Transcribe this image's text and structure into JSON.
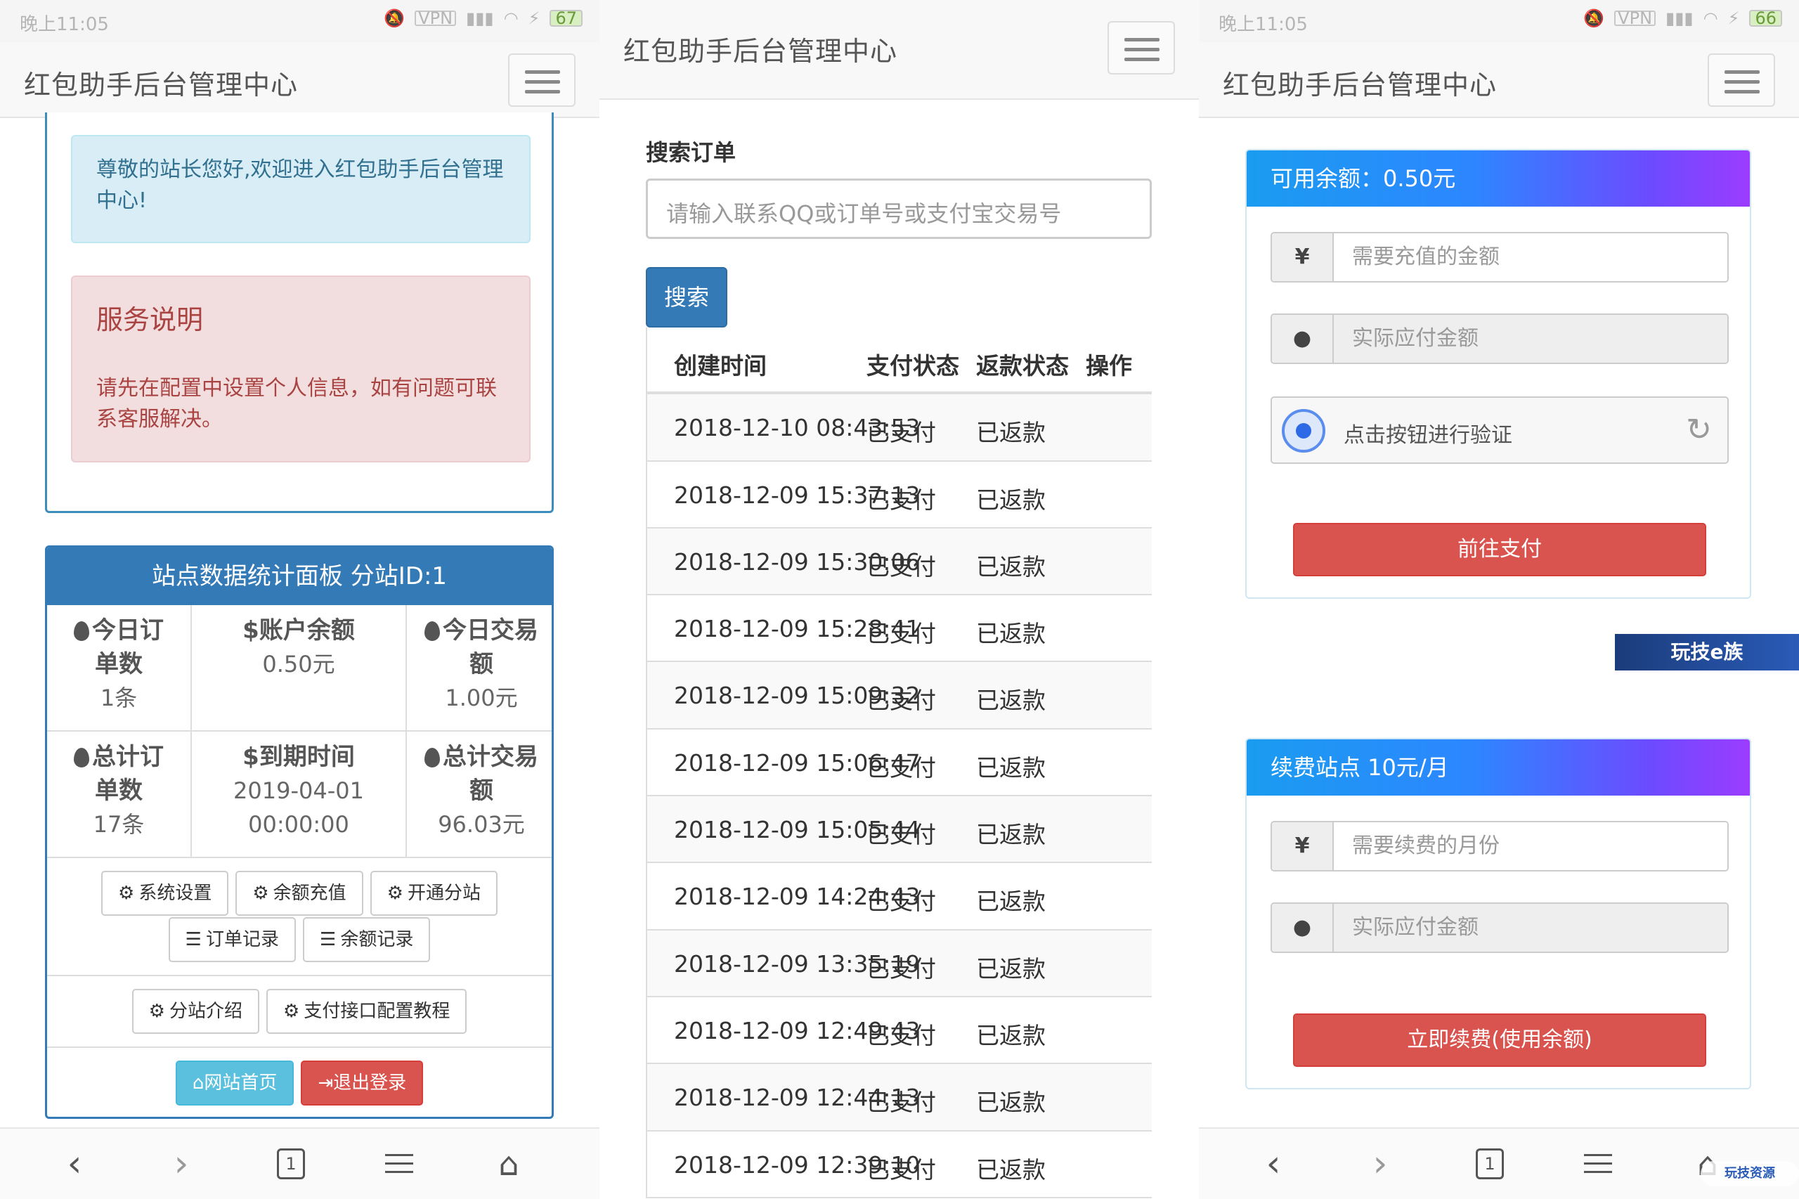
{
  "status_left": {
    "time": "晚上11:05",
    "battery": "67"
  },
  "status_right": {
    "time": "晚上11:05",
    "battery": "66"
  },
  "vpn": "VPN",
  "brand": "红包助手后台管理中心",
  "panel1": {
    "welcome": "尊敬的站长您好,欢迎进入红包助手后台管理中心!",
    "service_title": "服务说明",
    "service_text": "请先在配置中设置个人信息，如有问题可联系客服解决。",
    "stats_title": "站点数据统计面板 分站ID:1",
    "stats": [
      {
        "label": "今日订单数",
        "value": "1条"
      },
      {
        "label": "账户余额",
        "value": "0.50元"
      },
      {
        "label": "今日交易额",
        "value": "1.00元"
      },
      {
        "label": "总计订单数",
        "value": "17条"
      },
      {
        "label": "到期时间",
        "value": "2019-04-01 00:00:00"
      },
      {
        "label": "总计交易额",
        "value": "96.03元"
      }
    ],
    "stats_lines": {
      "l0a": "今日订",
      "l0b": "单数",
      "l1a": "账户余额",
      "l2a": "今日交易",
      "l2b": "额",
      "l3a": "总计订",
      "l3b": "单数",
      "l4a": "到期时间",
      "v4a": "2019-04-01",
      "v4b": "00:00:00",
      "l5a": "总计交易",
      "l5b": "额"
    },
    "buttons": {
      "settings": "系统设置",
      "recharge": "余额充值",
      "open_branch": "开通分站",
      "order_log": "订单记录",
      "balance_log": "余额记录",
      "branch_intro": "分站介绍",
      "pay_tutorial": "支付接口配置教程",
      "home": "网站首页",
      "logout": "退出登录"
    }
  },
  "panel2": {
    "title": "搜索订单",
    "placeholder": "请输入联系QQ或订单号或支付宝交易号",
    "search_btn": "搜索",
    "columns": [
      "创建时间",
      "支付状态",
      "返款状态",
      "操作"
    ],
    "rows": [
      [
        "2018-12-10 08:43:53",
        "已支付",
        "已返款"
      ],
      [
        "2018-12-09 15:37:13",
        "已支付",
        "已返款"
      ],
      [
        "2018-12-09 15:30:06",
        "已支付",
        "已返款"
      ],
      [
        "2018-12-09 15:28:41",
        "已支付",
        "已返款"
      ],
      [
        "2018-12-09 15:09:32",
        "已支付",
        "已返款"
      ],
      [
        "2018-12-09 15:06:47",
        "已支付",
        "已返款"
      ],
      [
        "2018-12-09 15:05:44",
        "已支付",
        "已返款"
      ],
      [
        "2018-12-09 14:24:43",
        "已支付",
        "已返款"
      ],
      [
        "2018-12-09 13:35:19",
        "已支付",
        "已返款"
      ],
      [
        "2018-12-09 12:49:43",
        "已支付",
        "已返款"
      ],
      [
        "2018-12-09 12:44:13",
        "已支付",
        "已返款"
      ],
      [
        "2018-12-09 12:39:10",
        "已支付",
        "已返款"
      ]
    ]
  },
  "panel3": {
    "balance_title": "可用余额：0.50元",
    "amount_placeholder": "需要充值的金额",
    "pay_placeholder": "实际应付金额",
    "captcha_text": "点击按钮进行验证",
    "pay_btn": "前往支付",
    "renew_title": "续费站点 10元/月",
    "months_placeholder": "需要续费的月份",
    "renew_pay_placeholder": "实际应付金额",
    "renew_btn": "立即续费(使用余额)",
    "yen": "¥"
  },
  "watermark": "玩技e族",
  "watermark2": "玩技资源",
  "bottom": {
    "tab_count": "1"
  },
  "colors": {
    "primary": "#337ab7",
    "danger": "#d9534f",
    "info": "#5bc0de"
  }
}
